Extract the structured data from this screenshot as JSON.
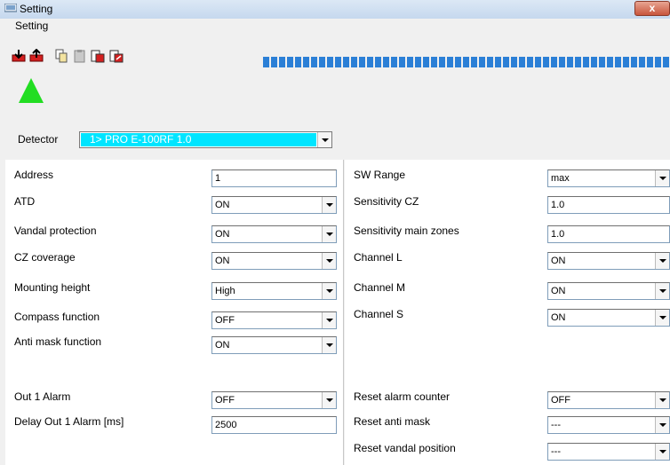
{
  "window": {
    "title": "Setting",
    "close_label": "x"
  },
  "menu": [
    "Setting"
  ],
  "toolbar": {
    "icons": [
      "import-red-icon",
      "export-red-icon",
      "copy-icon",
      "paste-icon",
      "save-file-icon",
      "load-file-icon"
    ]
  },
  "status": {
    "color": "#22dd22",
    "progress_color": "#2b7fd6",
    "progress_segments": 64
  },
  "detector": {
    "label": "Detector",
    "value": "1> PRO E-100RF 1.0"
  },
  "left_settings": [
    {
      "label": "Address",
      "value": "1",
      "type": "text"
    },
    {
      "label": "ATD",
      "value": "ON",
      "type": "select"
    },
    {
      "label": "Vandal protection",
      "value": "ON",
      "type": "select"
    },
    {
      "label": "CZ coverage",
      "value": "ON",
      "type": "select"
    },
    {
      "label": "Mounting height",
      "value": "High",
      "type": "select"
    },
    {
      "label": "Compass function",
      "value": "OFF",
      "type": "select"
    },
    {
      "label": "Anti mask function",
      "value": "ON",
      "type": "select"
    },
    {
      "label": "Out 1 Alarm",
      "value": "OFF",
      "type": "select"
    },
    {
      "label": "Delay Out 1 Alarm [ms]",
      "value": "2500",
      "type": "text"
    }
  ],
  "right_settings": [
    {
      "label": "SW Range",
      "value": "max",
      "type": "select"
    },
    {
      "label": "Sensitivity CZ",
      "value": "1.0",
      "type": "text"
    },
    {
      "label": "Sensitivity main zones",
      "value": "1.0",
      "type": "text"
    },
    {
      "label": "Channel L",
      "value": "ON",
      "type": "select"
    },
    {
      "label": "Channel M",
      "value": "ON",
      "type": "select"
    },
    {
      "label": "Channel S",
      "value": "ON",
      "type": "select"
    },
    {
      "label": "Reset alarm counter",
      "value": "OFF",
      "type": "select"
    },
    {
      "label": "Reset anti mask",
      "value": "---",
      "type": "select"
    },
    {
      "label": "Reset vandal position",
      "value": "---",
      "type": "select"
    }
  ]
}
